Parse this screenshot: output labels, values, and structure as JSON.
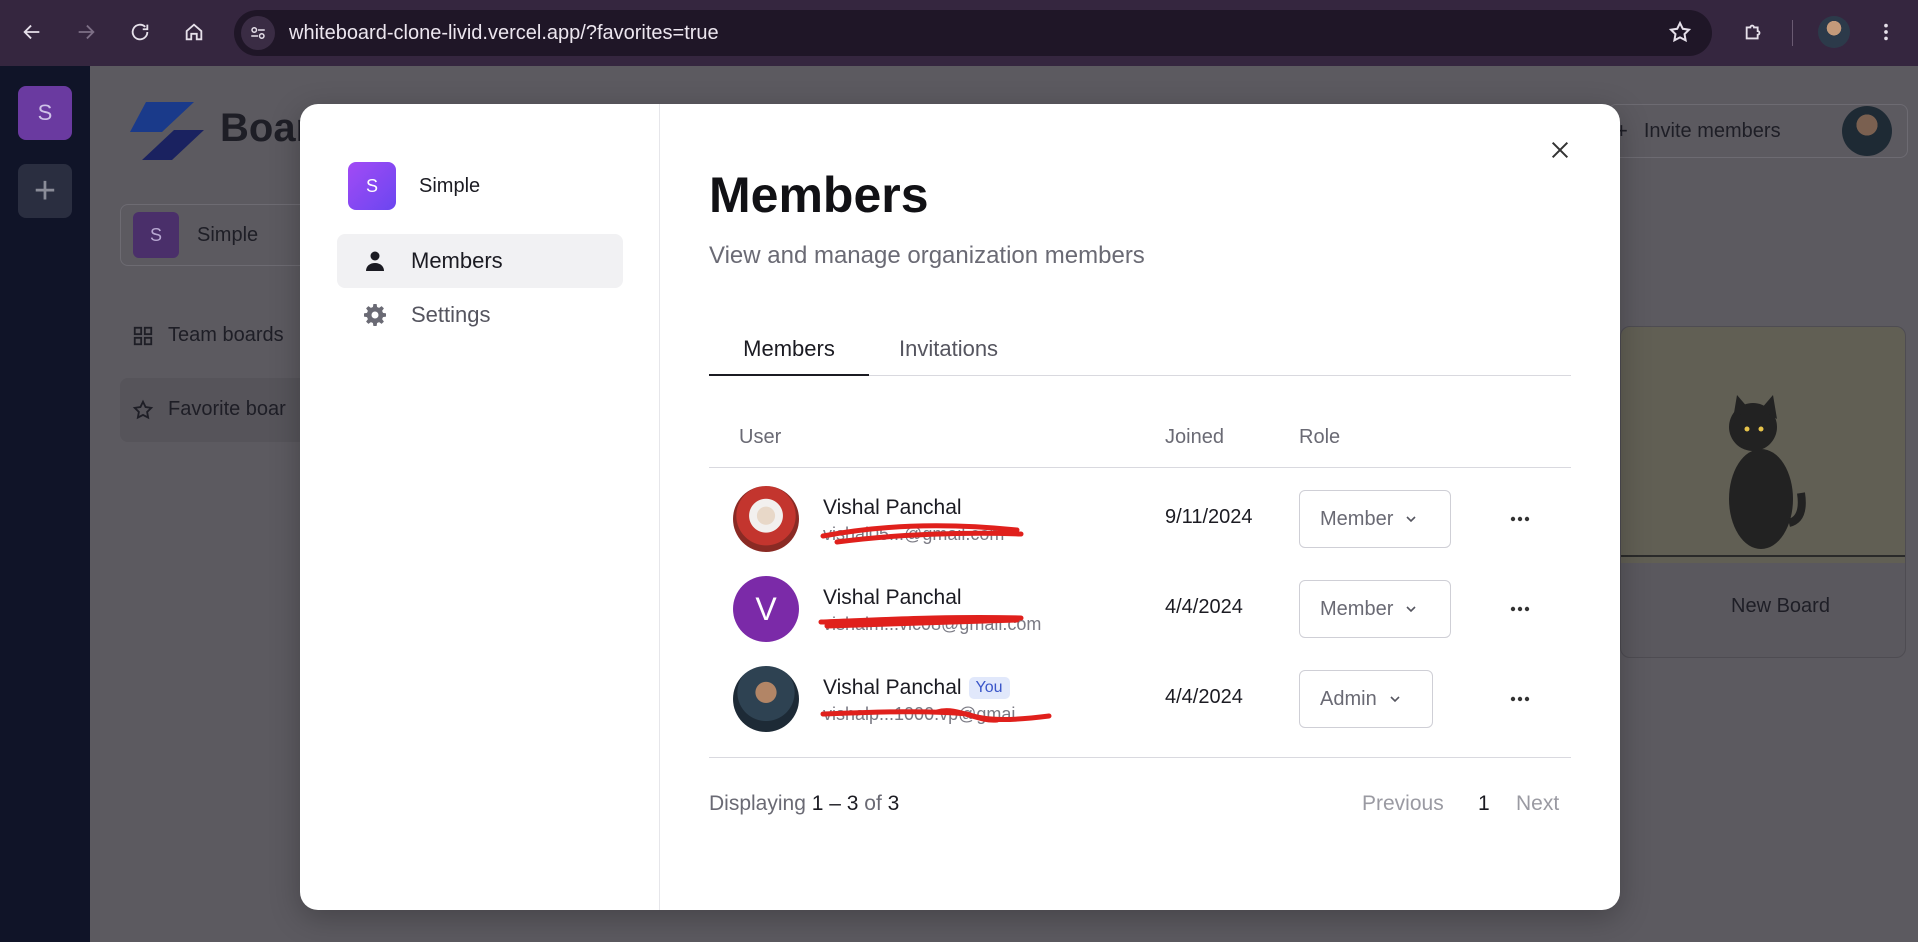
{
  "browser": {
    "url": "whiteboard-clone-livid.vercel.app/?favorites=true"
  },
  "background": {
    "rail_org_initial": "S",
    "brand_name": "Boar",
    "org_initial": "S",
    "org_name": "Simple",
    "nav_team_boards": "Team boards",
    "nav_favorite_boards": "Favorite boar",
    "invite_label": "Invite members",
    "card_title": "New Board"
  },
  "modal": {
    "org_initial": "S",
    "org_name": "Simple",
    "sidebar": {
      "items": [
        {
          "label": "Members",
          "icon": "person-icon",
          "active": true
        },
        {
          "label": "Settings",
          "icon": "gear-icon",
          "active": false
        }
      ]
    },
    "title": "Members",
    "subtitle": "View and manage organization members",
    "tabs": [
      {
        "label": "Members",
        "active": true
      },
      {
        "label": "Invitations",
        "active": false
      }
    ],
    "table": {
      "columns": [
        "User",
        "Joined",
        "Role"
      ],
      "rows": [
        {
          "name": "Vishal Panchal",
          "email": "vishal05...@gmail.com",
          "joined": "9/11/2024",
          "role": "Member",
          "you": ""
        },
        {
          "name": "Vishal Panchal",
          "email": "vishalm...vic08@gmail.com",
          "joined": "4/4/2024",
          "role": "Member",
          "you": ""
        },
        {
          "name": "Vishal Panchal",
          "email": "vishalp...1000.vp@gmai",
          "joined": "4/4/2024",
          "role": "Admin",
          "you": "You",
          "avatar_letter": ""
        }
      ],
      "row2_avatar_letter": "V"
    },
    "footer": {
      "displaying": "Displaying",
      "range": "1 – 3",
      "of": "of",
      "total": "3",
      "previous": "Previous",
      "page": "1",
      "next": "Next"
    }
  },
  "colors": {
    "accent_purple": "#7b2aa8",
    "org_gradient_start": "#a24bf5",
    "org_gradient_end": "#6b46f0",
    "you_badge_bg": "#e1e8fb",
    "redaction_red": "#e0201c"
  }
}
